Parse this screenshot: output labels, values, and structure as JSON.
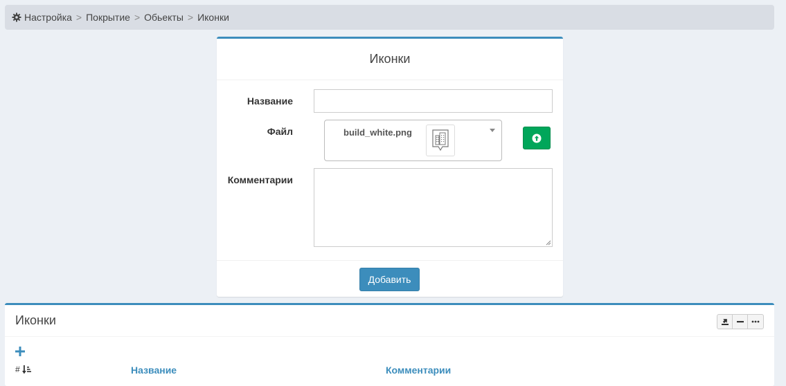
{
  "breadcrumb": {
    "items": [
      "Настройка",
      "Покрытие",
      "Обьекты",
      "Иконки"
    ],
    "separator": ">"
  },
  "form": {
    "title": "Иконки",
    "name_label": "Название",
    "name_value": "",
    "file_label": "Файл",
    "file_selected": "build_white.png",
    "comment_label": "Комментарии",
    "comment_value": "",
    "submit_label": "Добавить"
  },
  "list": {
    "title": "Иконки",
    "columns": {
      "hash": "#",
      "name": "Название",
      "comment": "Комментарии"
    }
  },
  "icons": {
    "breadcrumb_root": "gear-icon",
    "upload": "arrow-circle-up-icon",
    "file_preview": "building-marker-icon",
    "tool_export": "export-icon",
    "tool_collapse": "minus-icon",
    "tool_more": "ellipsis-icon",
    "add": "plus-icon",
    "sort": "sort-amount-down-icon"
  },
  "colors": {
    "accent": "#3c8dbc",
    "success": "#00a65a",
    "background": "#ecf0f5",
    "breadcrumb_bg": "#d9dde4"
  }
}
